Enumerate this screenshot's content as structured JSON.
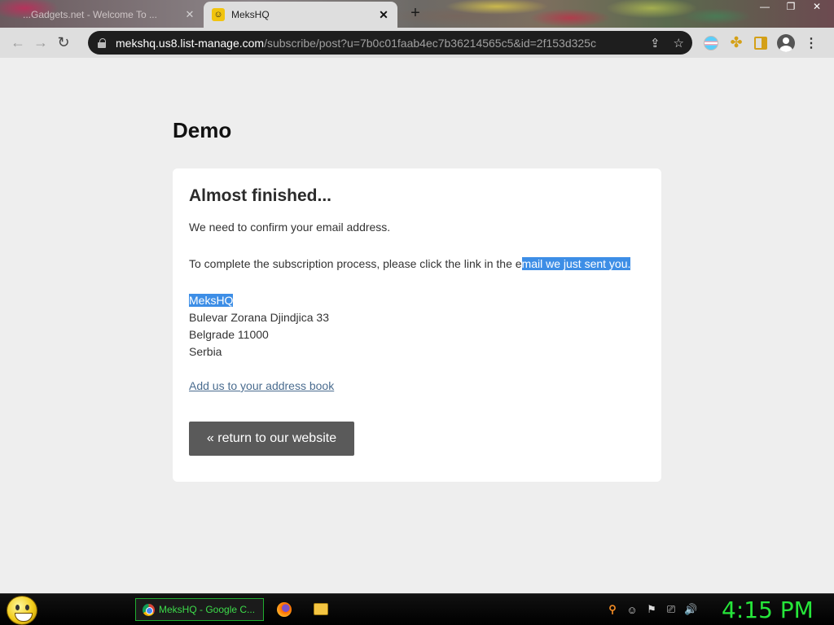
{
  "browser": {
    "tabs": [
      {
        "title": "...Gadgets.net - Welcome To ...",
        "active": false
      },
      {
        "title": "MeksHQ",
        "active": true
      }
    ],
    "url_host": "mekshq.us8.list-manage.com",
    "url_path": "/subscribe/post?u=7b0c01faab4ec7b36214565c5&id=2f153d325c"
  },
  "page": {
    "title": "Demo",
    "card": {
      "heading": "Almost finished...",
      "line1": "We need to confirm your email address.",
      "line2_plain": "To complete the subscription process, please click the link in the e",
      "line2_highlight": "mail we just sent you.",
      "address": {
        "name": "MeksHQ",
        "street": "Bulevar Zorana Djindjica 33",
        "city": "Belgrade 11000",
        "country": "Serbia"
      },
      "address_book_link": "Add us to your address book",
      "return_button": "« return to our website"
    }
  },
  "taskbar": {
    "task_title": "MeksHQ - Google C...",
    "clock": "4:15 PM"
  },
  "colors": {
    "highlight": "#3d8ee6",
    "clock": "#26e63a",
    "button": "#5a5a5a"
  }
}
